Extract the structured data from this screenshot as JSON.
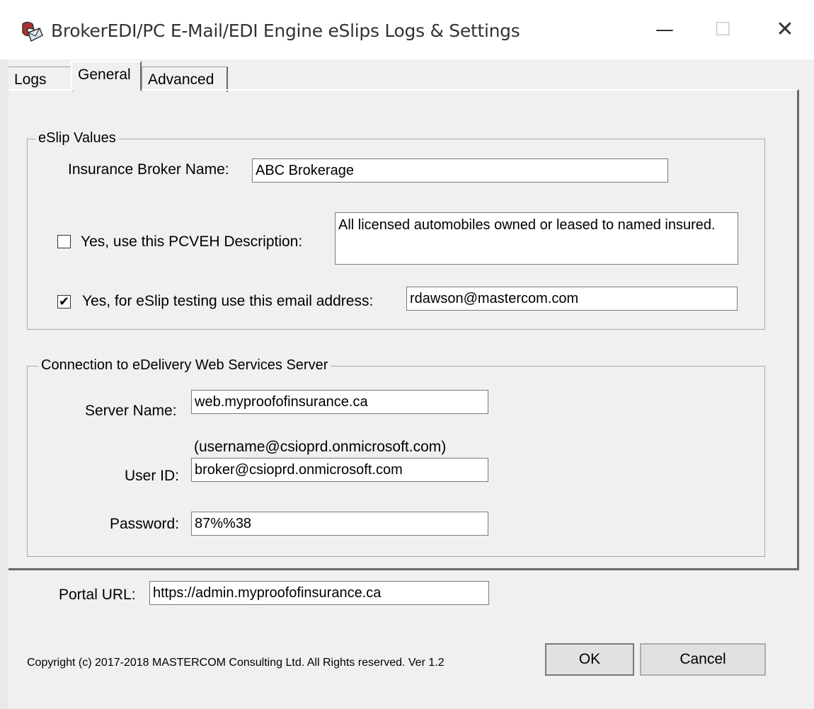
{
  "window": {
    "title": "BrokerEDI/PC E-Mail/EDI Engine eSlips Logs & Settings",
    "minimize": "—",
    "maximize": "☐",
    "close": "✕"
  },
  "tabs": [
    {
      "label": "Logs"
    },
    {
      "label": "General"
    },
    {
      "label": "Advanced"
    }
  ],
  "eslip": {
    "group_title": "eSlip Values",
    "broker_name_label": "Insurance Broker Name:",
    "broker_name_value": "ABC Brokerage",
    "pcveh_label": "Yes, use this PCVEH Description:",
    "pcveh_checked": false,
    "pcveh_value": "All licensed automobiles owned or leased to named insured.",
    "test_email_label": "Yes, for eSlip testing use this email address:",
    "test_email_checked": true,
    "test_email_value": "rdawson@mastercom.com"
  },
  "connection": {
    "group_title": "Connection to eDelivery Web Services Server",
    "server_label": "Server Name:",
    "server_value": "web.myproofofinsurance.ca",
    "userid_hint": "(username@csioprd.onmicrosoft.com)",
    "userid_label": "User ID:",
    "userid_value": "broker@csioprd.onmicrosoft.com",
    "password_label": "Password:",
    "password_value": "87%%38"
  },
  "portal": {
    "label": "Portal URL:",
    "value": "https://admin.myproofofinsurance.ca"
  },
  "footer": {
    "copyright": "Copyright (c) 2017-2018 MASTERCOM Consulting Ltd. All Rights reserved. Ver 1.2",
    "ok_label": "OK",
    "cancel_label": "Cancel"
  }
}
